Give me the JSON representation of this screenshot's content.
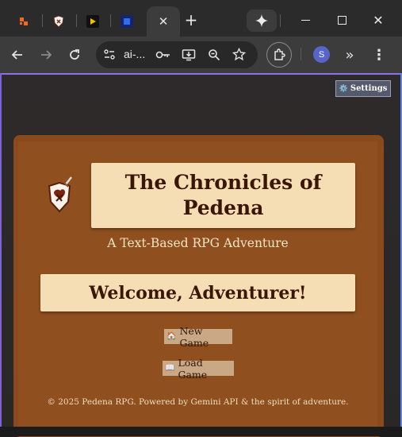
{
  "browser": {
    "tabs": [
      {
        "icon": "generic-app-icon",
        "active": false
      },
      {
        "icon": "shield-icon",
        "active": false
      },
      {
        "icon": "video-app-icon",
        "active": false
      },
      {
        "icon": "blue-app-icon",
        "active": false
      },
      {
        "icon": "close-icon",
        "active": true
      }
    ],
    "address": "ai-...",
    "profile_initial": "S"
  },
  "page": {
    "settings_label": "Settings",
    "settings_icon": "⚙️",
    "title": "The Chronicles of Pedena",
    "subtitle": "A Text-Based RPG Adventure",
    "welcome": "Welcome, Adventurer!",
    "new_game_label": "New Game",
    "new_game_icon": "🏠",
    "load_game_label": "Load Game",
    "load_game_icon": "📖",
    "footer": "© 2025 Pedena RPG. Powered by Gemini API & the spirit of adventure."
  },
  "colors": {
    "card": "#8b4a1c",
    "parchment": "#f5deb3",
    "title_text": "#3a1606",
    "frame_glow": "#7e63d8"
  }
}
